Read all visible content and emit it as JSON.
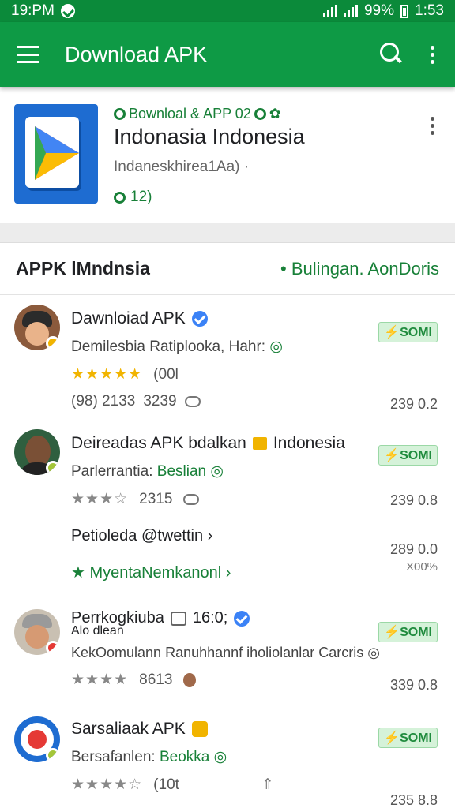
{
  "status": {
    "time": "19:PM",
    "battery": "99%",
    "clock": "1:53"
  },
  "appbar": {
    "title": "Download APK",
    "search_icon": "search-icon",
    "menu_icon": "more-vert-icon"
  },
  "featured": {
    "tag": "Bownloal & APP 02",
    "title": "Indonasia Indonesia",
    "subtitle": "Indaneskhirea1Aa) ·",
    "meta": "12)"
  },
  "section": {
    "title": "APPK lMndnsia",
    "link": "Bulingan. AonDoris"
  },
  "rows": [
    {
      "name": "Dawnloiad APK",
      "desc": "Demilesbia Ratiplooka, Hahr:",
      "stars": "★★★★★",
      "rating_count": "(00l",
      "meta1": "(98) 2133",
      "meta2": "3239",
      "pill": "SOMI",
      "value": "239 0.2"
    },
    {
      "name": "Deireadas APK bdalkan",
      "name_tail": "Indonesia",
      "desc_a": "Parlerrantia:",
      "desc_b": "Beslian",
      "stars": "★★★☆",
      "meta1": "2315",
      "pill": "SOMI",
      "value": "239 0.8",
      "sub_title": "Petioleda @twettin ›",
      "sub_value": "289 0.0",
      "sub_value2": "X00%",
      "sub_link": "MyentaNemkanonl ›"
    },
    {
      "name": "Perrkogkiuba",
      "name_tail": "16:0;",
      "name_line2": "Alo dlean",
      "desc": "KekOomulann Ranuhhannf iholiolanlar Carcris",
      "stars": "★★★★",
      "meta1": "8613",
      "pill": "SOMI",
      "value": "339 0.8"
    },
    {
      "name": "Sarsaliaak APK",
      "desc_a": "Bersafanlen:",
      "desc_b": "Beokka",
      "stars": "★★★★☆",
      "meta1": "(10t",
      "pill": "SOMI",
      "value": "235 8.8"
    }
  ]
}
